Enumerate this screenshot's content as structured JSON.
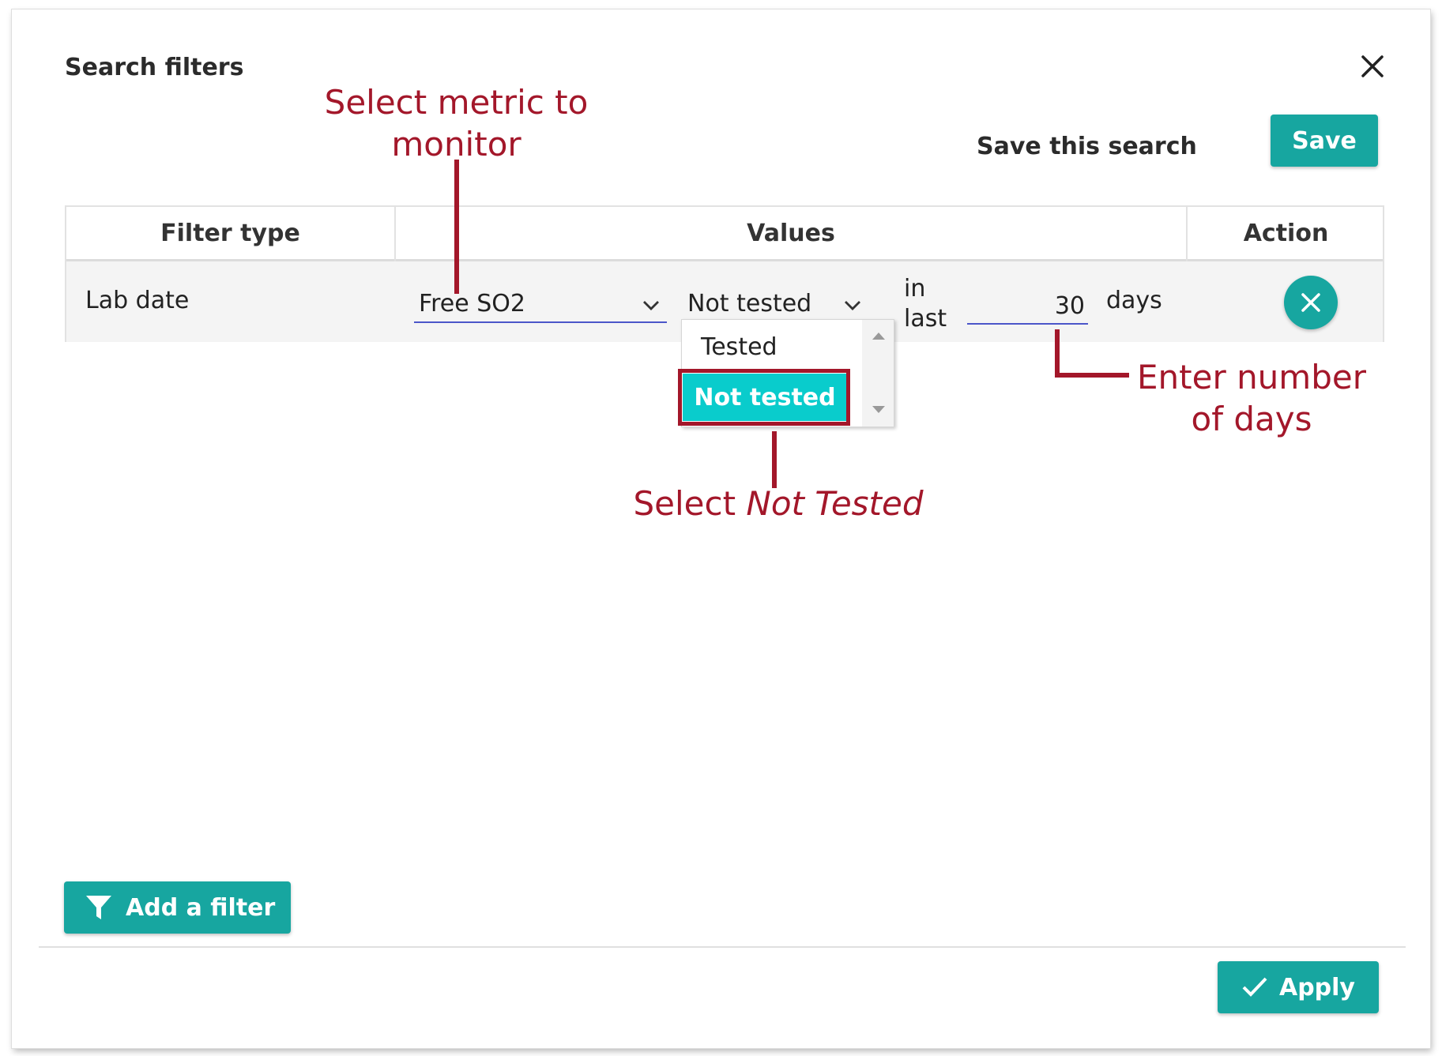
{
  "dialog": {
    "title": "Search filters",
    "save_search_label": "Save this search",
    "save_button": "Save",
    "add_filter_button": "Add a filter",
    "apply_button": "Apply"
  },
  "table": {
    "headers": [
      "Filter type",
      "Values",
      "Action"
    ],
    "rows": [
      {
        "filter_type": "Lab date",
        "metric": "Free SO2",
        "status": "Not tested",
        "in_last_label": "in last",
        "days_value": "30",
        "days_label": "days"
      }
    ]
  },
  "dropdown": {
    "options": [
      "Tested",
      "Not tested"
    ],
    "selected": "Not tested"
  },
  "annotations": {
    "metric": "Select metric to monitor",
    "days": "Enter number of days",
    "not_tested_prefix": "Select",
    "not_tested_emphasis": "Not Tested"
  },
  "colors": {
    "accent": "#17a6a0",
    "highlight": "#09cccc",
    "annotation": "#a3172a",
    "underline": "#4b56c9"
  }
}
